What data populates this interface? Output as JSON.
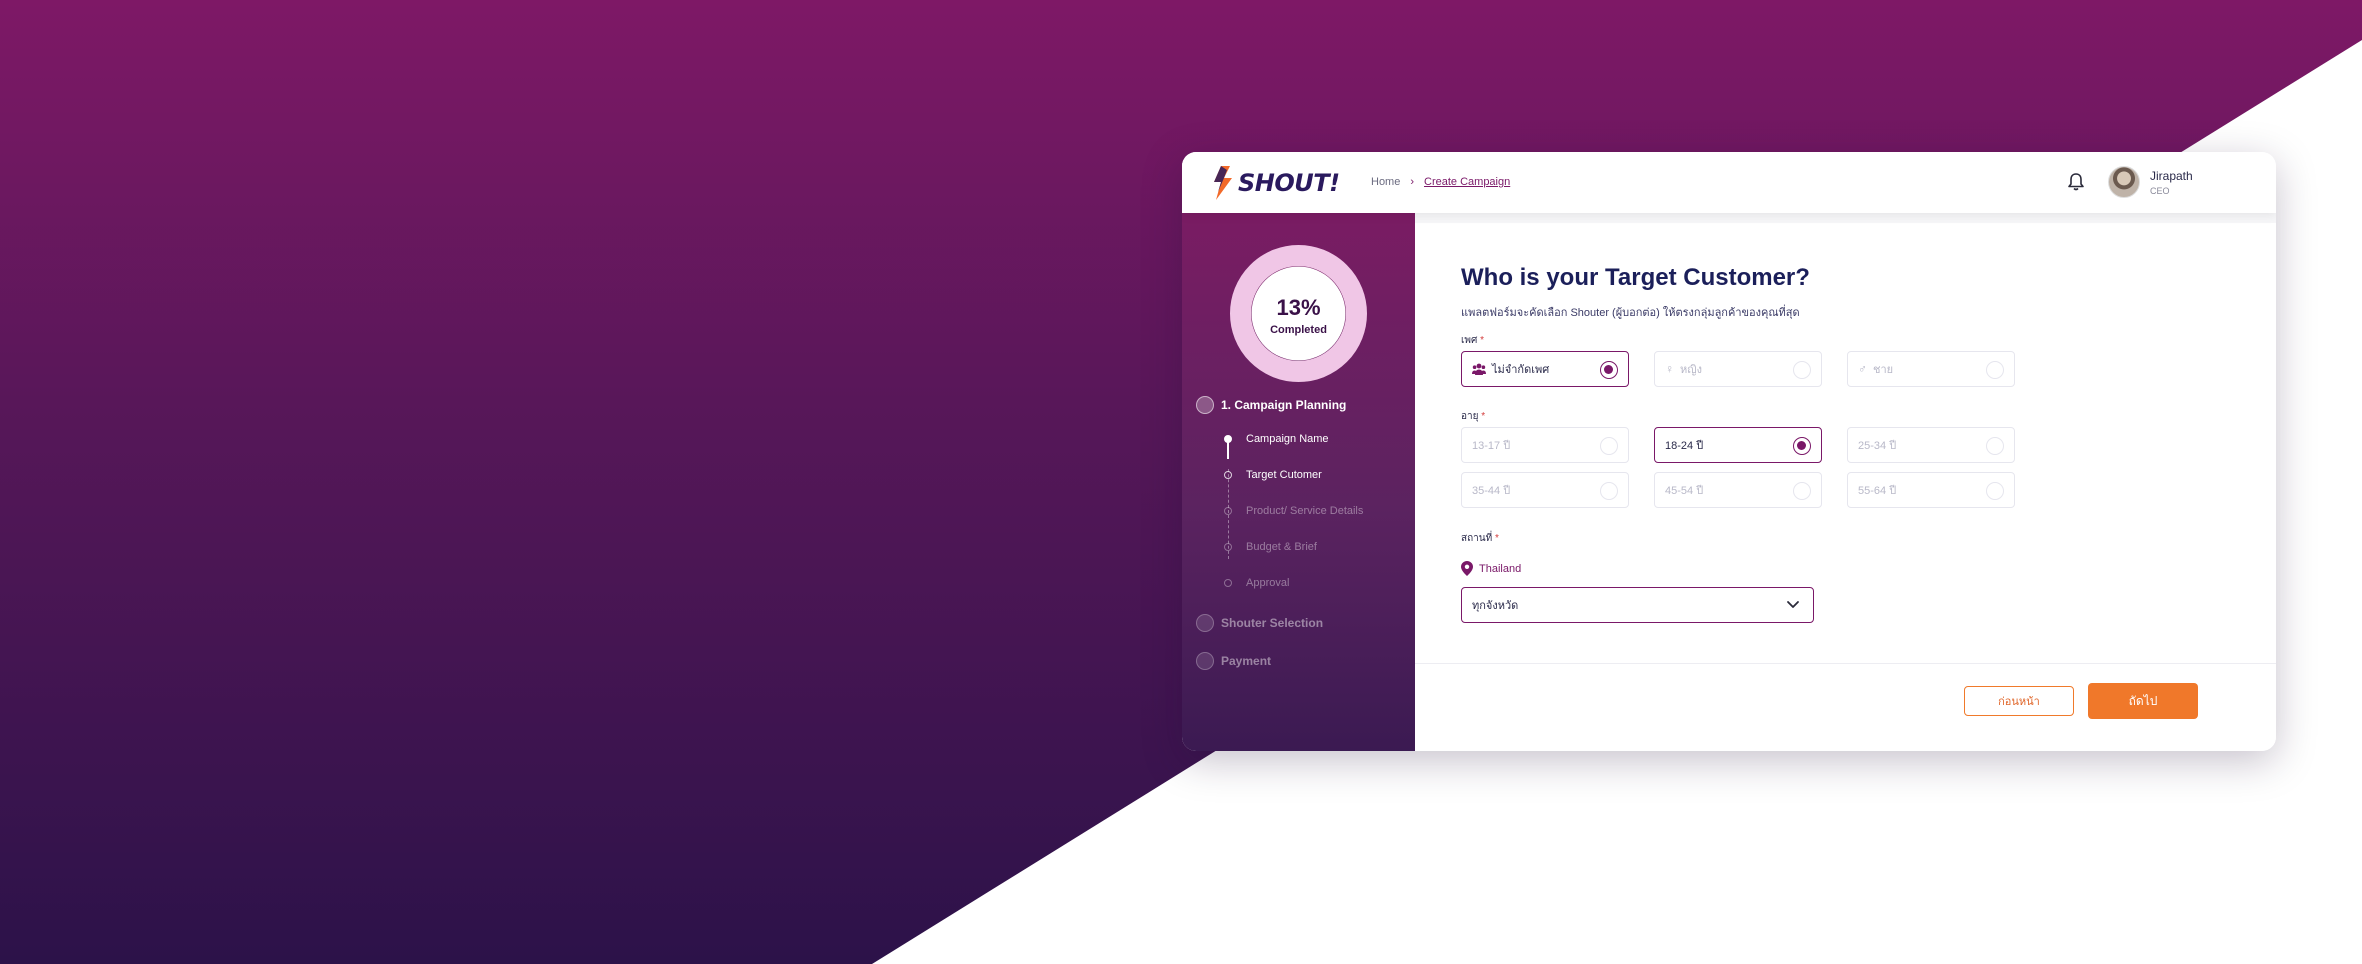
{
  "header": {
    "logo_text": "SHOUT!",
    "breadcrumb": {
      "home": "Home",
      "separator": "›",
      "current": "Create Campaign"
    },
    "user": {
      "name": "Jirapath",
      "role": "CEO"
    }
  },
  "sidebar": {
    "progress": {
      "percent_label": "13%",
      "completed_label": "Completed",
      "value": 0.13
    },
    "steps": [
      {
        "label": "1. Campaign Planning",
        "substeps": [
          {
            "label": "Campaign Name"
          },
          {
            "label": "Target Cutomer"
          },
          {
            "label": "Product/ Service Details"
          },
          {
            "label": "Budget & Brief"
          },
          {
            "label": "Approval"
          }
        ]
      },
      {
        "label": "Shouter Selection"
      },
      {
        "label": "Payment"
      }
    ]
  },
  "main": {
    "title": "Who is your Target Customer?",
    "subtitle": "แพลตฟอร์มจะคัดเลือก Shouter (ผู้บอกต่อ) ให้ตรงกลุ่มลูกค้าของคุณที่สุด",
    "gender": {
      "label": "เพศ",
      "required": "*",
      "options": [
        {
          "label": "ไม่จำกัดเพศ",
          "selected": true
        },
        {
          "label": "หญิง",
          "selected": false
        },
        {
          "label": "ชาย",
          "selected": false
        }
      ]
    },
    "age": {
      "label": "อายุ",
      "required": "*",
      "options": [
        {
          "label": "13-17 ปี",
          "selected": false
        },
        {
          "label": "18-24 ปี",
          "selected": true
        },
        {
          "label": "25-34 ปี",
          "selected": false
        },
        {
          "label": "35-44 ปี",
          "selected": false
        },
        {
          "label": "45-54 ปี",
          "selected": false
        },
        {
          "label": "55-64 ปี",
          "selected": false
        }
      ]
    },
    "location": {
      "label": "สถานที่",
      "required": "*",
      "country": "Thailand",
      "province_value": "ทุกจังหวัด"
    },
    "buttons": {
      "prev": "ก่อนหน้า",
      "next": "ถัดไป"
    }
  },
  "colors": {
    "brand": "#7a1868",
    "accent": "#f0782a",
    "title": "#1b1f5a"
  },
  "icons": [
    "shout-logo-icon",
    "bell-icon",
    "users-icon",
    "female-icon",
    "male-icon",
    "location-pin-icon",
    "chevron-down-icon"
  ]
}
